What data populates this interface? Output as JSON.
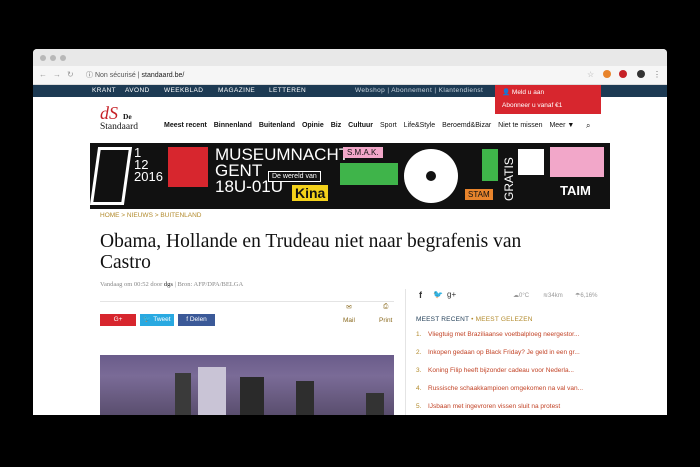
{
  "browser": {
    "security_label": "Non sécurisé",
    "url": "standaard.be/"
  },
  "topnav": {
    "left_items": [
      "KRANT",
      "AVOND",
      "WEEKBLAD",
      "MAGAZINE",
      "LETTEREN"
    ],
    "right_text": "Webshop | Abonnement | Klantendienst"
  },
  "login": {
    "login_label": "Meld u aan",
    "subscribe_label": "Abonneer u vanaf €1"
  },
  "logo": {
    "line1": "dS",
    "line2": "De",
    "line3": "Standaard"
  },
  "mainnav": {
    "items": [
      "Meest recent",
      "Binnenland",
      "Buitenland",
      "Opinie",
      "Biz",
      "Cultuur",
      "Sport",
      "Life&Style",
      "Beroemd&Bizar",
      "Niet te missen",
      "Meer ▼"
    ]
  },
  "banner": {
    "date_line1": "1",
    "date_line2": "12",
    "date_line3": "2016",
    "title": "MUSEUMNACHT",
    "city": "GENT",
    "time": "18U-01U",
    "tagline": "De wereld van",
    "kina": "Kina",
    "smak": "S.M.A.K.",
    "gratis": "GRATIS",
    "stam": "STAM",
    "miat": "MIAT"
  },
  "breadcrumb": "HOME > NIEUWS > BUITENLAND",
  "article": {
    "headline": "Obama, Hollande en Trudeau niet naar begrafenis van Castro",
    "byline_pre": "Vandaag om 00:52 door ",
    "byline_author": "dgs",
    "byline_post": " | Bron: AFP/DPA/BELGA",
    "share_gplus": "G+",
    "share_tweet": "Tweet",
    "share_delen": "Delen",
    "mail_label": "Mail",
    "print_label": "Print"
  },
  "sidebar": {
    "weather_temp": "0°C",
    "weather_wind": "34km",
    "weather_rain": "6,16%",
    "tab_recent": "MEEST RECENT",
    "tab_sep": "•",
    "tab_read": "MEEST GELEZEN",
    "items": [
      {
        "num": "1.",
        "text": "Vliegtuig met Braziliaanse voetbalploeg neergestor..."
      },
      {
        "num": "2.",
        "text": "Inkopen gedaan op Black Friday? Je geld in een gr..."
      },
      {
        "num": "3.",
        "text": "Koning Filip heeft bijzonder cadeau voor Nederla..."
      },
      {
        "num": "4.",
        "text": "Russische schaakkampioen omgekomen na val van..."
      },
      {
        "num": "5.",
        "text": "IJsbaan met ingevroren vissen sluit na protest"
      }
    ]
  },
  "colors": {
    "navy": "#1d3a53",
    "red": "#d7262e",
    "gold": "#b28a2b"
  }
}
